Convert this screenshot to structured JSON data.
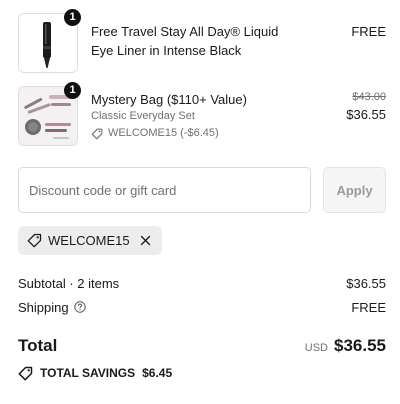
{
  "line_items": [
    {
      "quantity": "1",
      "title": "Free Travel Stay All Day® Liquid Eye Liner in Intense Black",
      "price": "FREE",
      "image_icon": "eyeliner-product-image"
    },
    {
      "quantity": "1",
      "title": "Mystery Bag ($110+ Value)",
      "variant": "Classic Everyday Set",
      "discount": "WELCOME15 (-$6.45)",
      "original_price": "$43.00",
      "price": "$36.55",
      "image_icon": "cosmetics-set-product-image"
    }
  ],
  "discount_form": {
    "placeholder": "Discount code or gift card",
    "value": "",
    "apply_label": "Apply"
  },
  "applied_code": {
    "code": "WELCOME15",
    "tag_icon": "tag-icon",
    "remove_icon": "close-icon"
  },
  "summary": {
    "subtotal_label": "Subtotal · 2 items",
    "subtotal_value": "$36.55",
    "shipping_label": "Shipping",
    "shipping_value": "FREE",
    "total_label": "Total",
    "currency": "USD",
    "total_value": "$36.55",
    "savings_label": "TOTAL SAVINGS",
    "savings_value": "$6.45"
  },
  "colors": {
    "text": "#1a1a1a",
    "muted": "#707070",
    "chip_bg": "#ececec",
    "button_bg": "#f5f5f5",
    "badge_bg": "#111111"
  }
}
